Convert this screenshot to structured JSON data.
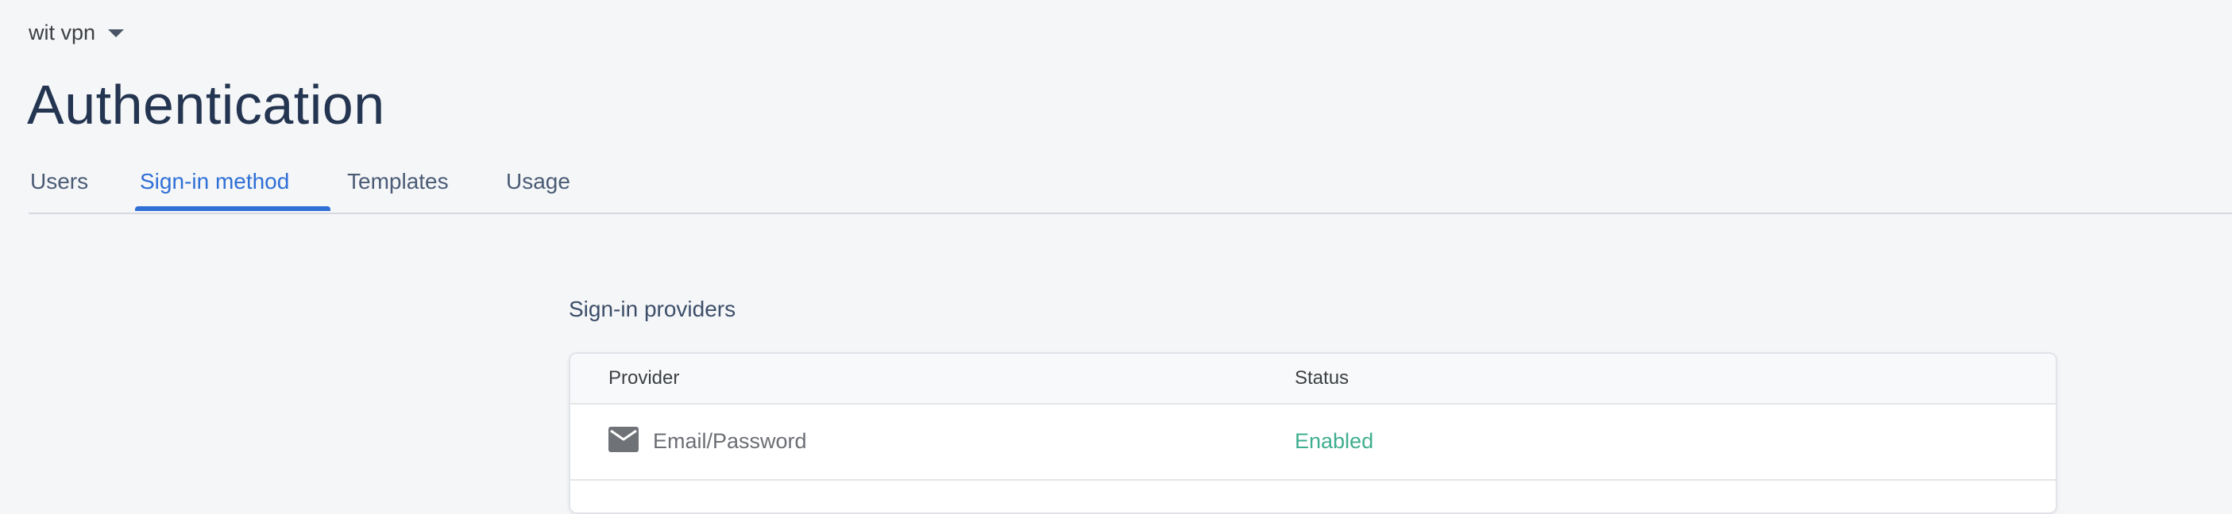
{
  "project": {
    "name": "wit vpn"
  },
  "page": {
    "title": "Authentication"
  },
  "tabs": [
    {
      "label": "Users",
      "active": false
    },
    {
      "label": "Sign-in method",
      "active": true
    },
    {
      "label": "Templates",
      "active": false
    },
    {
      "label": "Usage",
      "active": false
    }
  ],
  "providers_section": {
    "title": "Sign-in providers",
    "columns": {
      "provider": "Provider",
      "status": "Status"
    },
    "rows": [
      {
        "icon": "mail-icon",
        "provider": "Email/Password",
        "status": "Enabled"
      }
    ]
  },
  "colors": {
    "accent": "#2f6fd6",
    "enabled": "#3fae8e",
    "title": "#243551",
    "background": "#f5f6f8"
  }
}
